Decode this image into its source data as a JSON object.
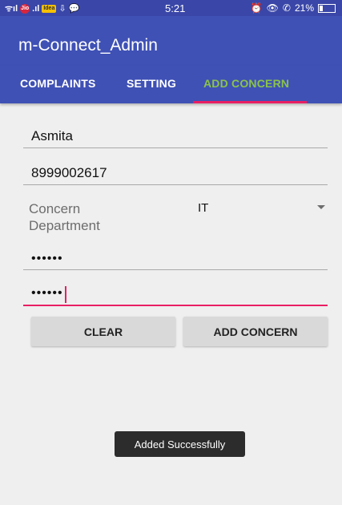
{
  "status_bar": {
    "time": "5:21",
    "battery": "21%",
    "carrier_badges": [
      "Jio",
      "Idea"
    ],
    "accent": "#3a47a8"
  },
  "app": {
    "title": "m-Connect_Admin",
    "primary_color": "#3f51b5",
    "accent_color": "#e91e63",
    "active_tab_color": "#8bc34a"
  },
  "tabs": [
    {
      "label": "COMPLAINTS",
      "active": false
    },
    {
      "label": "SETTING",
      "active": false
    },
    {
      "label": "ADD CONCERN",
      "active": true
    }
  ],
  "form": {
    "name_value": "Asmita",
    "phone_value": "8999002617",
    "department_label": "Concern Department",
    "department_selected": "IT",
    "password_value": "••••••",
    "confirm_password_value": "••••••"
  },
  "buttons": {
    "clear_label": "CLEAR",
    "add_label": "ADD CONCERN"
  },
  "toast": {
    "message": "Added Successfully"
  }
}
